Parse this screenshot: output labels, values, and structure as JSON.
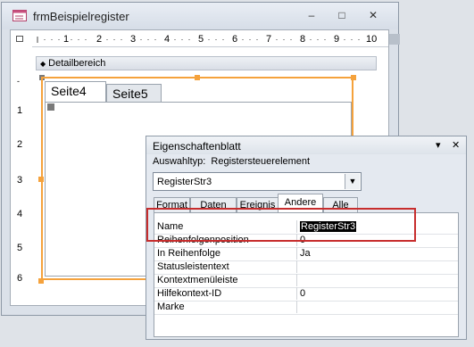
{
  "form_window": {
    "title": "frmBeispielregister",
    "minimize_glyph": "–",
    "maximize_glyph": "□",
    "close_glyph": "✕",
    "ruler_labels": [
      "1",
      "2",
      "3",
      "4",
      "5",
      "6",
      "7",
      "8",
      "9",
      "10"
    ],
    "vruler_labels": [
      "1",
      "2",
      "3",
      "4",
      "5",
      "6",
      "7",
      "8"
    ],
    "section_bar": {
      "arrow": "◆",
      "label": "Detailbereich"
    },
    "tabs": [
      {
        "label": "Seite4",
        "active": true
      },
      {
        "label": "Seite5",
        "active": false
      }
    ]
  },
  "property_sheet": {
    "title": "Eigenschaftenblatt",
    "pin_glyph": "▾",
    "close_glyph": "✕",
    "selection_type": "Auswahltyp:  Registersteuerelement",
    "selected_object": "RegisterStr3",
    "combo_arrow": "▼",
    "tabs": [
      "Format",
      "Daten",
      "Ereignis",
      "Andere",
      "Alle"
    ],
    "active_tab": "Andere",
    "rows": [
      {
        "name": "Name",
        "value": "RegisterStr3"
      },
      {
        "name": "Reihenfolgenposition",
        "value": "0"
      },
      {
        "name": "In Reihenfolge",
        "value": "Ja"
      },
      {
        "name": "Statusleistentext",
        "value": ""
      },
      {
        "name": "Kontextmenüleiste",
        "value": ""
      },
      {
        "name": "Hilfekontext-ID",
        "value": "0"
      },
      {
        "name": "Marke",
        "value": ""
      }
    ]
  },
  "colors": {
    "selection_outline": "#f5a23c",
    "highlight_box": "#c72d2d"
  }
}
